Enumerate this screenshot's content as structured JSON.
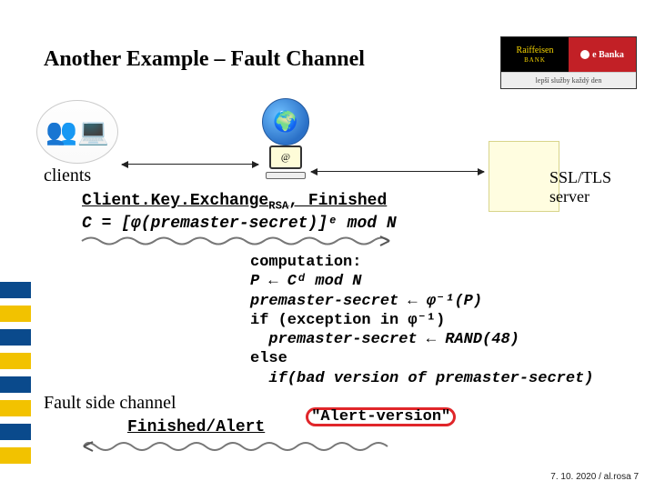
{
  "title": "Another Example – Fault Channel",
  "logo": {
    "bank_name": "Raiffeisen",
    "bank_sub": "BANK",
    "ebanka": "e Banka",
    "tagline": "lepší služby každý den"
  },
  "clients_label": "clients",
  "server_label": "SSL/TLS server",
  "exchange": {
    "line1_a": "Client.Key.Exchange",
    "line1_sub": "RSA",
    "line1_b": ", Finished",
    "line2": "C = [φ(premaster-secret)]ᵉ mod N"
  },
  "computation": {
    "l1": "computation:",
    "l2": "P ← Cᵈ mod N",
    "l3": "premaster-secret ← φ⁻¹(P)",
    "l4": "if (exception in φ⁻¹)",
    "l5": "  premaster-secret ← RAND(48)",
    "l6": "else",
    "l7": "  if(bad version of premaster-secret)",
    "alert": "\"Alert-version\""
  },
  "fault_label": "Fault side channel",
  "finished_alert": "Finished/Alert",
  "footer": "7. 10. 2020 / al.rosa      7",
  "icons": {
    "globe": "globe-icon",
    "pc": "pc-icon",
    "users": "users-icon"
  }
}
